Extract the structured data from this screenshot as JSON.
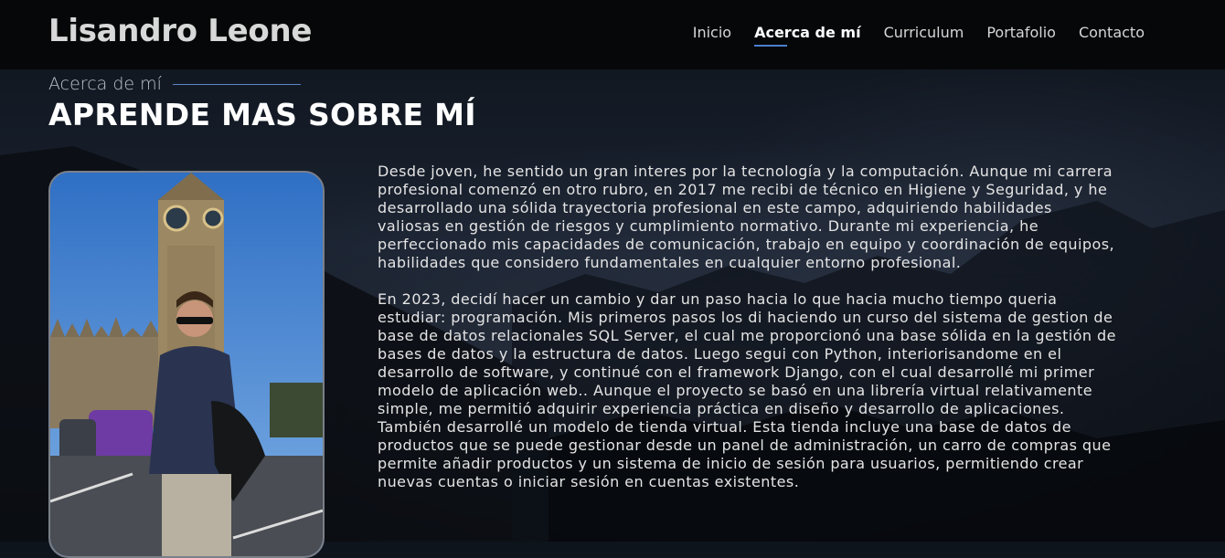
{
  "header": {
    "brand": "Lisandro Leone",
    "nav": [
      {
        "label": "Inicio",
        "active": false
      },
      {
        "label": "Acerca de mí",
        "active": true
      },
      {
        "label": "Curriculum",
        "active": false
      },
      {
        "label": "Portafolio",
        "active": false
      },
      {
        "label": "Contacto",
        "active": false
      }
    ]
  },
  "about": {
    "label": "Acerca de mí",
    "title": "APRENDE MAS SOBRE MÍ",
    "photo_alt": "Foto de Lisandro Leone frente al Big Ben",
    "paragraphs": [
      "Desde joven, he sentido un gran interes por la tecnología y la computación. Aunque mi carrera profesional comenzó en otro rubro, en 2017 me recibi de técnico en Higiene y Seguridad, y he desarrollado una sólida trayectoria profesional en este campo, adquiriendo habilidades valiosas en gestión de riesgos y cumplimiento normativo. Durante mi experiencia, he perfeccionado mis capacidades de comunicación, trabajo en equipo y coordinación de equipos, habilidades que considero fundamentales en cualquier entorno profesional.",
      "En 2023, decidí hacer un cambio y dar un paso hacia lo que hacia mucho tiempo queria estudiar: programación. Mis primeros pasos los di haciendo un curso del sistema de gestion de base de datos relacionales SQL Server, el cual me proporcionó una base sólida en la gestión de bases de datos y la estructura de datos. Luego segui con Python, interiorisandome en el desarrollo de software, y continué con el framework Django, con el cual desarrollé mi primer modelo de aplicación web.. Aunque el proyecto se basó en una librería virtual relativamente simple, me permitió adquirir experiencia práctica en diseño y desarrollo de aplicaciones. También desarrollé un modelo de tienda virtual. Esta tienda incluye una base de datos de productos que se puede gestionar desde un panel de administración, un carro de compras que permite añadir productos y un sistema de inicio de sesión para usuarios, permitiendo crear nuevas cuentas o iniciar sesión en cuentas existentes."
    ]
  },
  "colors": {
    "navbar_bg": "#060708",
    "accent": "#4a7fd0",
    "text": "#e4e4e4"
  }
}
